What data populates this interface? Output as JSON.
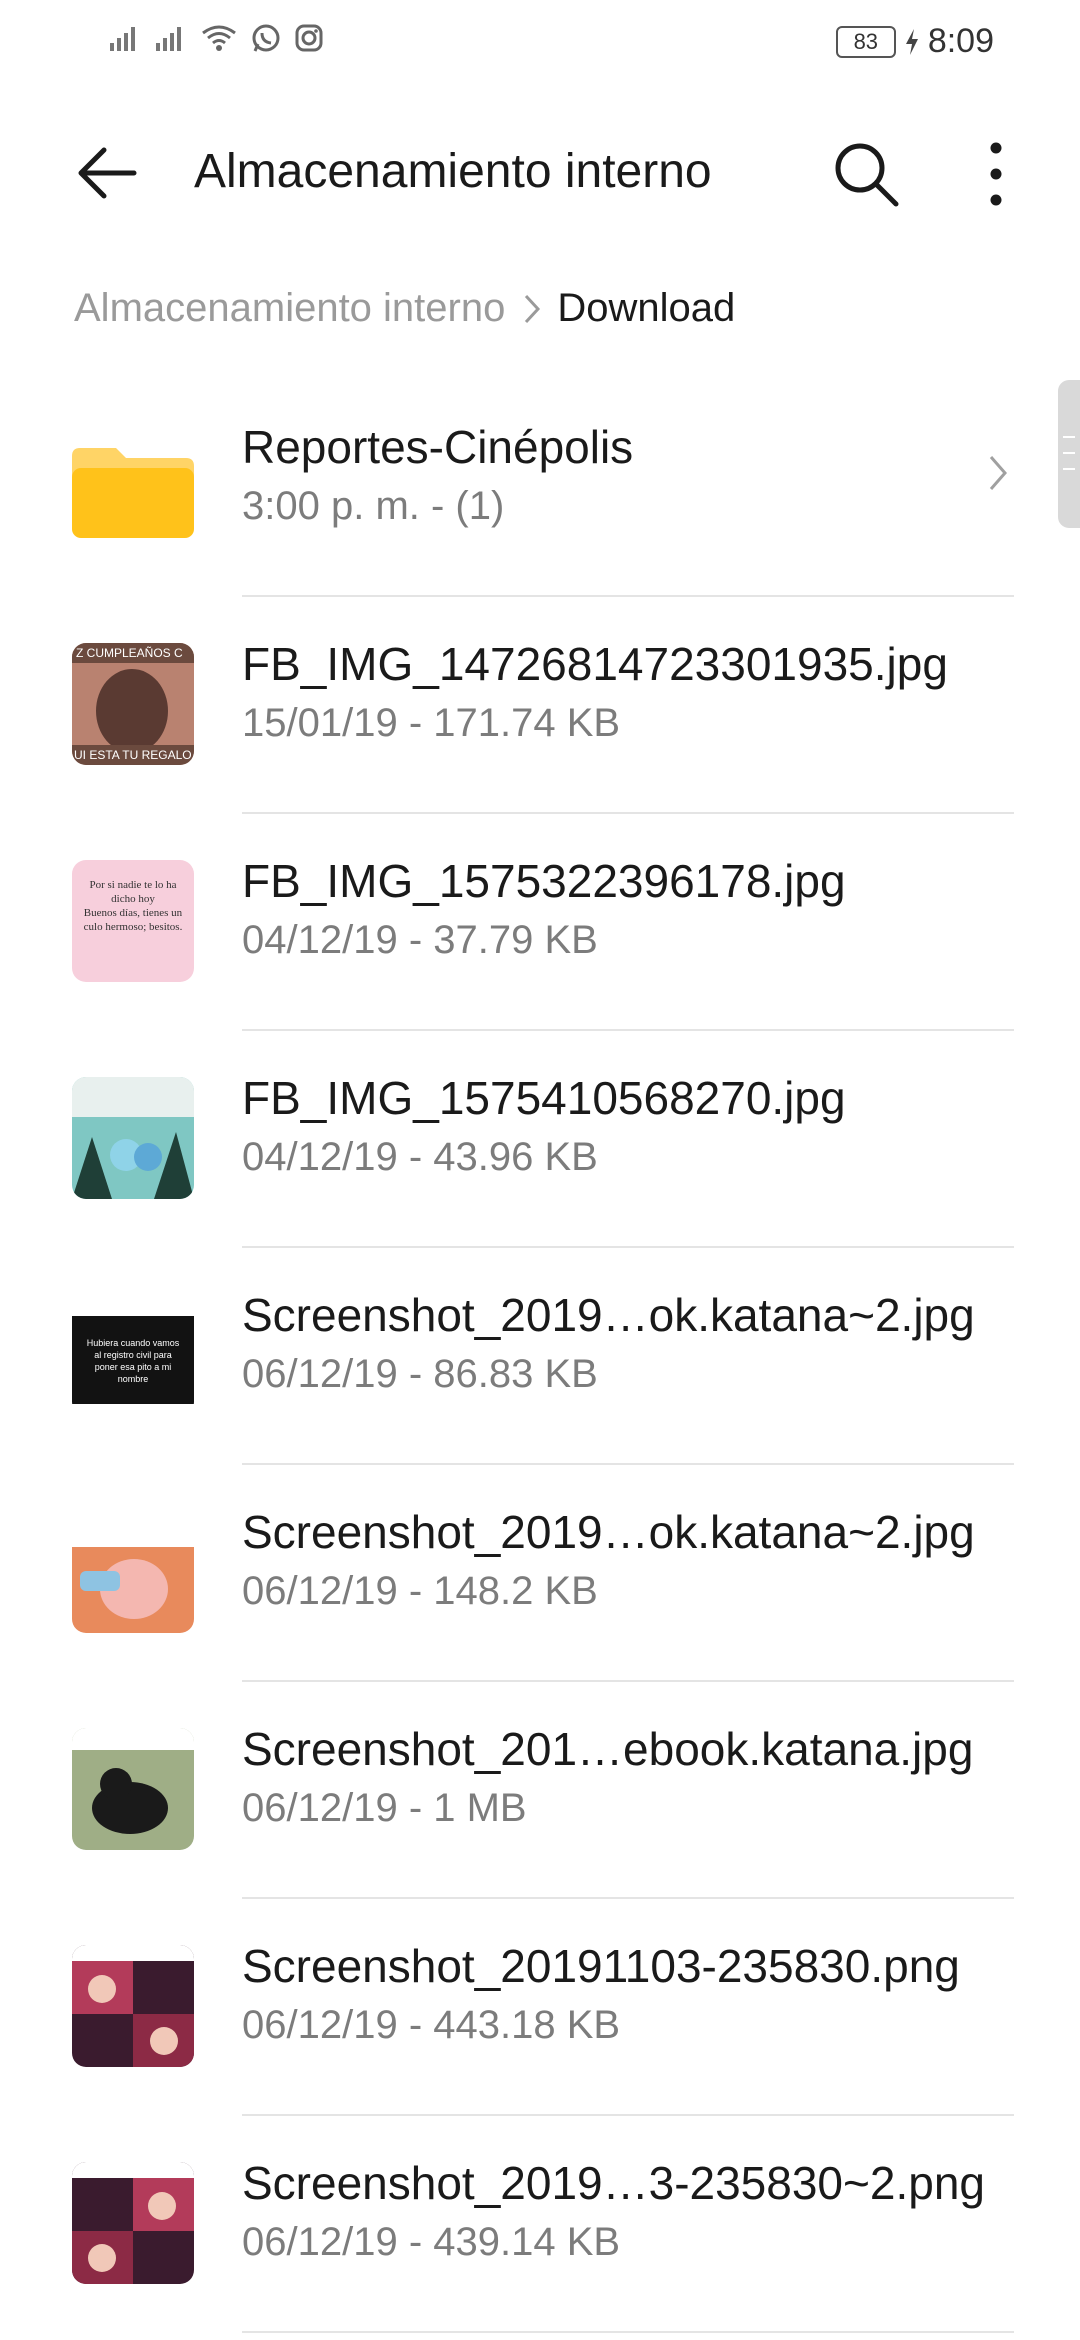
{
  "status_bar": {
    "battery": "83",
    "time": "8:09"
  },
  "header": {
    "title": "Almacenamiento interno"
  },
  "breadcrumb": {
    "root": "Almacenamiento interno",
    "current": "Download"
  },
  "items": [
    {
      "type": "folder",
      "name": "Reportes-Cinépolis",
      "meta": "3:00 p. m. - (1)",
      "icon": "folder-icon"
    },
    {
      "type": "image",
      "name": "FB_IMG_14726814723301935.jpg",
      "meta": "15/01/19 - 171.74 KB",
      "thumb_colors": [
        "#6b4a3e",
        "#c98a74"
      ],
      "thumb_label_top": "Z CUMPLEAÑOS C",
      "thumb_label_bottom": "UI ESTA TU REGALO"
    },
    {
      "type": "image",
      "name": "FB_IMG_1575322396178.jpg",
      "meta": "04/12/19 - 37.79 KB",
      "thumb_colors": [
        "#f5c6d6",
        "#f9d9e4"
      ],
      "thumb_text": "Por si nadie te lo ha dicho hoy Buenos días, tienes un culo hermoso; besitos."
    },
    {
      "type": "image",
      "name": "FB_IMG_1575410568270.jpg",
      "meta": "04/12/19 - 43.96 KB",
      "thumb_colors": [
        "#2f5f56",
        "#7fc7c3"
      ]
    },
    {
      "type": "image",
      "name": "Screenshot_2019…ok.katana~2.jpg",
      "meta": "06/12/19 - 86.83 KB",
      "thumb_colors": [
        "#111111",
        "#222222"
      ],
      "thumb_text": "Hubiera cuando veamos al registro civil para poner esa pito a mi nombre"
    },
    {
      "type": "image",
      "name": "Screenshot_2019…ok.katana~2.jpg",
      "meta": "06/12/19 - 148.2 KB",
      "thumb_colors": [
        "#e07a4f",
        "#f3b8a0"
      ]
    },
    {
      "type": "image",
      "name": "Screenshot_201…ebook.katana.jpg",
      "meta": "06/12/19 - 1 MB",
      "thumb_colors": [
        "#2b2b2b",
        "#8fa17a"
      ]
    },
    {
      "type": "image",
      "name": "Screenshot_20191103-235830.png",
      "meta": "06/12/19 - 443.18 KB",
      "thumb_colors": [
        "#3a1b2e",
        "#b33b5a"
      ]
    },
    {
      "type": "image",
      "name": "Screenshot_2019…3-235830~2.png",
      "meta": "06/12/19 - 439.14 KB",
      "thumb_colors": [
        "#3a1b2e",
        "#b33b5a"
      ]
    }
  ],
  "colors": {
    "folder": "#FFC21A",
    "folder_tab": "#FFD466",
    "text_secondary": "#7c7c7c",
    "divider": "#e4e4e4"
  }
}
